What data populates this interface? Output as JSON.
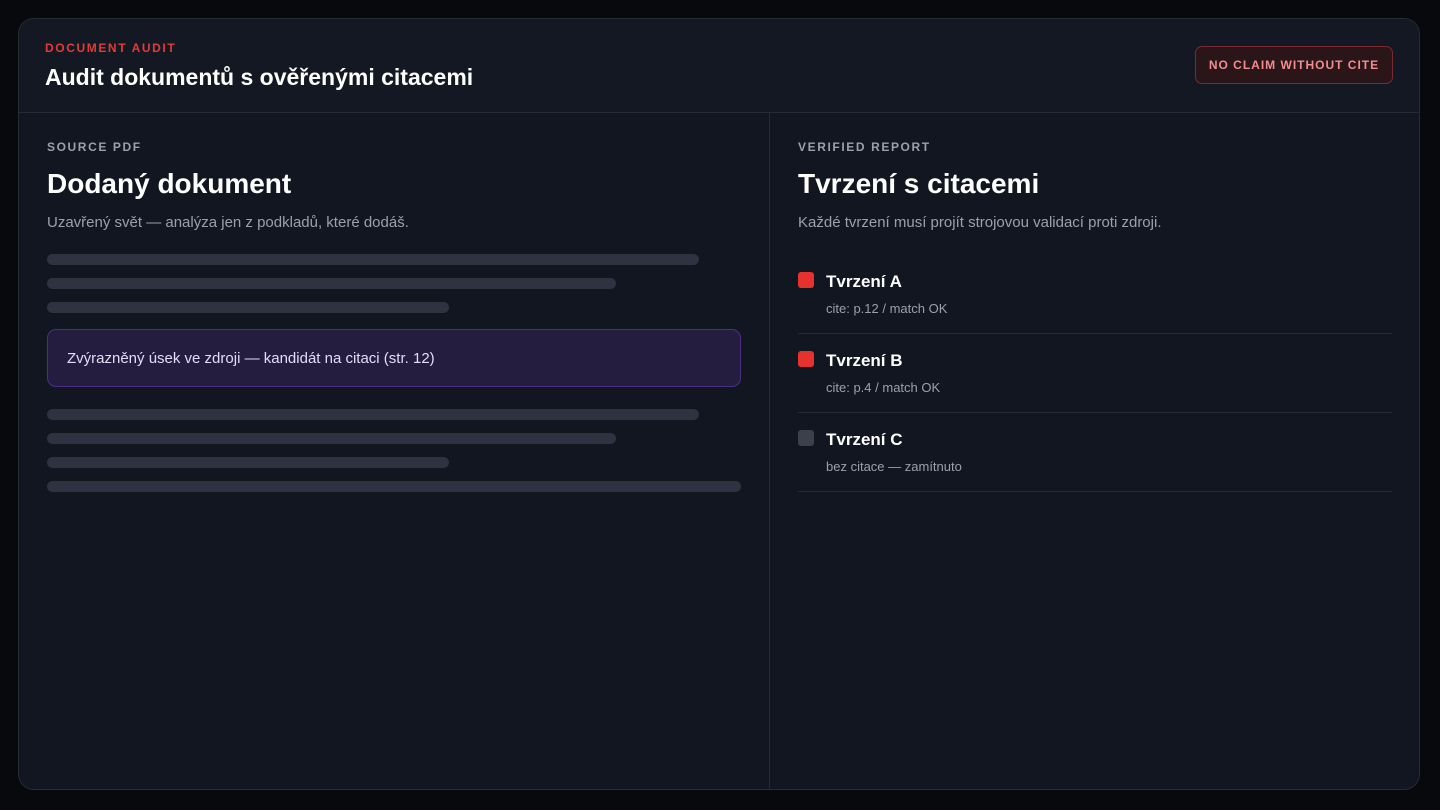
{
  "header": {
    "kicker": "DOCUMENT AUDIT",
    "title": "Audit dokumentů s ověřenými citacemi",
    "badge": "NO CLAIM WITHOUT CITE"
  },
  "source": {
    "eyebrow": "SOURCE PDF",
    "title": "Dodaný dokument",
    "subtitle": "Uzavřený svět — analýza jen z podkladů, které dodáš.",
    "highlight": "Zvýrazněný úsek ve zdroji — kandidát na citaci (str. 12)"
  },
  "report": {
    "eyebrow": "VERIFIED REPORT",
    "title": "Tvrzení s citacemi",
    "subtitle": "Každé tvrzení musí projít strojovou validací proti zdroji.",
    "claims": [
      {
        "title": "Tvrzení A",
        "meta": "cite: p.12 / match OK",
        "status": "verified",
        "color": "#e5322f"
      },
      {
        "title": "Tvrzení B",
        "meta": "cite: p.4 / match OK",
        "status": "verified",
        "color": "#e5322f"
      },
      {
        "title": "Tvrzení C",
        "meta": "bez citace — zamítnuto",
        "status": "rejected",
        "color": "#3b404b"
      }
    ]
  },
  "colors": {
    "accent": "#e23b3b",
    "highlight": "#251d40",
    "background": "#121620"
  }
}
